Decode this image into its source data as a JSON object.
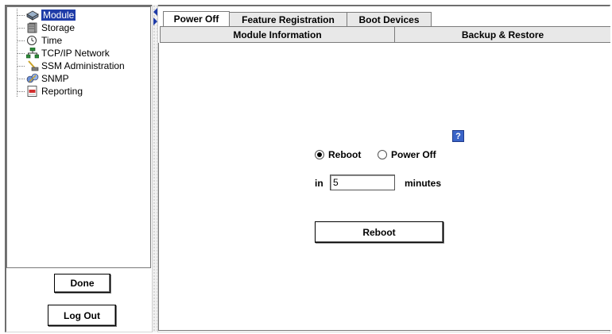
{
  "tree": {
    "items": [
      {
        "label": "Module",
        "icon": "module-icon",
        "selected": true
      },
      {
        "label": "Storage",
        "icon": "storage-icon"
      },
      {
        "label": "Time",
        "icon": "clock-icon"
      },
      {
        "label": "TCP/IP Network",
        "icon": "network-icon"
      },
      {
        "label": "SSM Administration",
        "icon": "admin-icon"
      },
      {
        "label": "SNMP",
        "icon": "snmp-icon"
      },
      {
        "label": "Reporting",
        "icon": "report-icon"
      }
    ]
  },
  "buttons": {
    "done": "Done",
    "logout": "Log Out",
    "action": "Reboot"
  },
  "tabs": {
    "row1": [
      "Power Off",
      "Feature Registration",
      "Boot Devices"
    ],
    "row2": [
      "Module Information",
      "Backup & Restore"
    ]
  },
  "form": {
    "help": "?",
    "radio_reboot": "Reboot",
    "radio_poweroff": "Power Off",
    "selected": "Reboot",
    "in_label": "in",
    "minutes_value": "5",
    "minutes_label": "minutes"
  },
  "colors": {
    "selection": "#1f3ca8",
    "help": "#3a64c8"
  }
}
